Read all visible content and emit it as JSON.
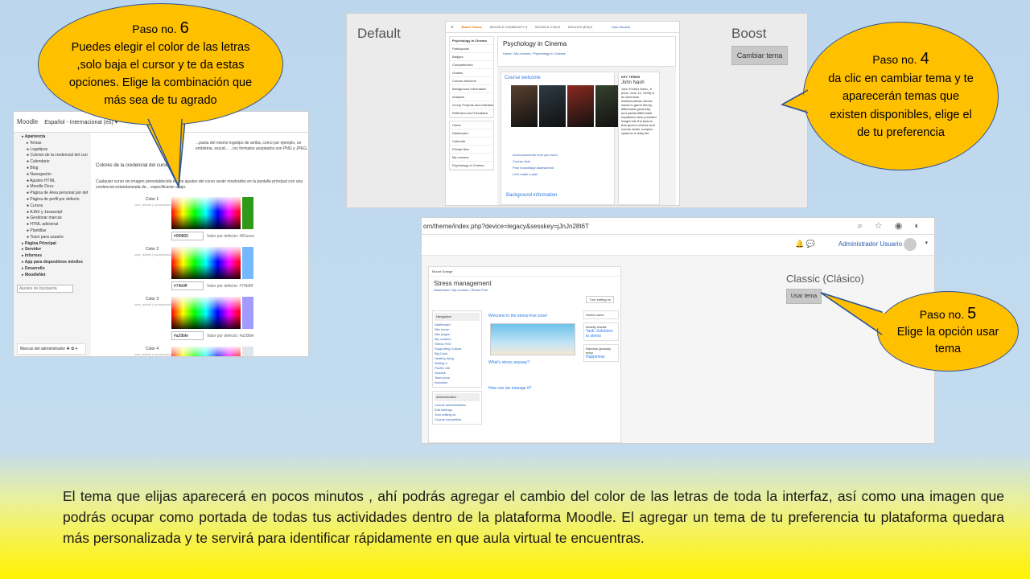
{
  "callouts": {
    "step6": {
      "paso": "Paso no.",
      "num": "6",
      "text": "Puedes elegir el color de las letras ,solo baja el cursor y te da estas opciones. Elige la combinación que más sea de tu agrado"
    },
    "step4": {
      "paso": "Paso no.",
      "num": "4",
      "text": "da clic en cambiar tema y te aparecerán temas que existen disponibles, elige el de tu preferencia"
    },
    "step5": {
      "paso": "Paso no.",
      "num": "5",
      "text": "Elige la opción usar tema"
    }
  },
  "shot1": {
    "brand": "Moodle",
    "lang": "Español - Internacional (es) ▾",
    "sidebar": [
      {
        "label": "▸ Apariencia",
        "head": true
      },
      {
        "label": "▸ Temas"
      },
      {
        "label": "● Logotipos"
      },
      {
        "label": "● Colores de la credencial del curso"
      },
      {
        "label": "● Calendario"
      },
      {
        "label": "● Blog"
      },
      {
        "label": "● Navegación"
      },
      {
        "label": "● Ajustes HTML"
      },
      {
        "label": "● Moodle Docs"
      },
      {
        "label": "● Página de Área personal por defecto"
      },
      {
        "label": "● Página de perfil por defecto"
      },
      {
        "label": "● Cursos"
      },
      {
        "label": "● AJAX y Javascript"
      },
      {
        "label": "● Gestionar marcas"
      },
      {
        "label": "● HTML adicional"
      },
      {
        "label": "● Plantillas"
      },
      {
        "label": "● Tours para usuario"
      },
      {
        "label": "▸ Página Principal",
        "head": true
      },
      {
        "label": "▸ Servidor",
        "head": true
      },
      {
        "label": "▸ Informes",
        "head": true
      },
      {
        "label": "▸ App para dispositivos móviles",
        "head": true
      },
      {
        "label": "▸ Desarrollo",
        "head": true
      },
      {
        "label": "▸ MoodleNet",
        "head": true
      }
    ],
    "search_placeholder": "Ajustes de búsqueda",
    "blocks_label": "Marcas del administrador ✚ ✿ ▾",
    "section_title": "Colores de la credencial del curso",
    "intro_text": "...pacta del mismo logotipo de arriba, como por ejemplo, un emblema, escud... ...los formatos aceptados son PNG y JPEG.",
    "desc_text": "Cualquier curso sin imagen preestablecida en los ajustes del curso serán mostrados en la pantalla principal con una credencial estandarizada de... especificarán abajo.",
    "colors": [
      {
        "label": "Color 1",
        "sub": "core_admin | coursecolor1",
        "value": "#0f9800",
        "default": "Valor por defecto: #81ecec",
        "chip": "#2f9a1a"
      },
      {
        "label": "Color 2",
        "sub": "core_admin | coursecolor2",
        "value": "#74b9ff",
        "default": "Valor por defecto: #74b9ff",
        "chip": "#74b9ff"
      },
      {
        "label": "Color 3",
        "sub": "core_admin | coursecolor3",
        "value": "#a29bfe",
        "default": "Valor por defecto: #a29bfe",
        "chip": "#a29bfe"
      },
      {
        "label": "Color 4",
        "sub": "core_admin | coursecolor4",
        "value": "",
        "default": "",
        "chip": "#dfe6e9"
      }
    ]
  },
  "shot2": {
    "left_title": "Default",
    "right_title": "Boost",
    "button": "Cambiar tema",
    "nav": [
      "Boost Theme",
      "MOODLE COMMUNITY ▾",
      "MOODLE.COM ▾",
      "ENGLISH (EN) ▾",
      "Sam Student"
    ],
    "sidebar_top": [
      "Psychology in Cinema",
      "Participants",
      "Badges",
      "Competencies",
      "Grades",
      "Course welcome",
      "Background information",
      "Analysis",
      "Group Projects and individual tasks",
      "Reflection and Feedback"
    ],
    "sidebar_bottom": [
      "Home",
      "Dashboard",
      "Calendar",
      "Private files",
      "My courses",
      "Psychology in Cinema"
    ],
    "course_title": "Psychology in Cinema",
    "breadcrumb": "Home / My courses / Psychology in Cinema",
    "welcome": "Course welcome",
    "activities": [
      "Announcements from your tutor",
      "Course chat",
      "Prior knowledge assessment",
      "Let's make a plan"
    ],
    "bg_info": "Background information",
    "key_terms": "KEY TERMS",
    "john": "John Nash",
    "john_text": "John Forbes Nash, Jr. (born June 13, 1928) is an American mathematician whose works in game theory, differential geometry, and partial differential equations have provided insight into the factors that govern chance and events inside complex systems in daily life.",
    "posters": [
      "#5a4030",
      "#2e3a44",
      "#8a2a20",
      "#35402e"
    ]
  },
  "shot3": {
    "url": "om/theme/index.php?device=legacy&sesskey=jJnJn28t6T",
    "browser_icons": "⌕ ☆ ◉ ◐",
    "admin_user": "Administrador Usuario",
    "bell": "🔔 💬",
    "caret": "▾",
    "title": "Classic (Clásico)",
    "button": "Usar tema",
    "site": "Mount Orange",
    "page_title": "Stress management",
    "breadcrumb": "Dashboard / My courses / Stress Free",
    "edit": "Turn editing on",
    "nav_title": "Navigation",
    "nav_items": [
      "Dashboard",
      "Site home",
      "Site pages",
      "My courses",
      "Stress Free",
      "Supporting Culture",
      "Big Cook",
      "Healthy living",
      "Writing 4",
      "Pacific Life",
      "Oceans",
      "Team prep",
      "Induction"
    ],
    "admin_title": "Administration",
    "admin_items": [
      "Course administration",
      "Edit settings",
      "Turn editing on",
      "Course completion"
    ],
    "welcome": "Welcome to the stress-free zone!",
    "q1": "What's stress anyway?",
    "q2": "How can we manage it?",
    "online": "Online users",
    "activity": "Activity results",
    "task": "Task: Solutions to stress",
    "glossary": "Random glossary entry",
    "happiness": "Happiness"
  },
  "bottom_text": "El tema que elijas  aparecerá en pocos minutos , ahí podrás agregar el cambio del color de las letras de toda la interfaz, así como una imagen que podrás ocupar como portada de todas tus actividades dentro de la plataforma Moodle. El agregar un tema de tu preferencia tu plataforma quedara  más personalizada y te servirá para identificar rápidamente en que aula virtual te encuentras.",
  "colors": {
    "callout_fill": "#ffc000",
    "callout_border": "#2f5597"
  }
}
